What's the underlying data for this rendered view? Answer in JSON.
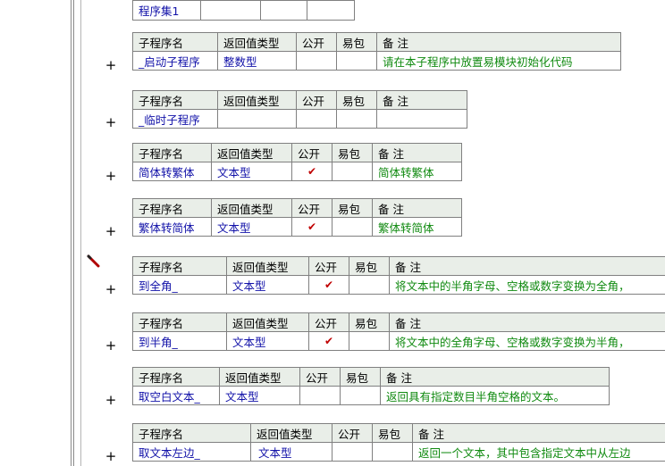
{
  "assembly": {
    "name": "程序集1"
  },
  "header_labels": {
    "sub_name": "子程序名",
    "return_type": "返回值类型",
    "public": "公开",
    "easy_pkg": "易包",
    "note": "备 注"
  },
  "expand_symbol": "+",
  "check_mark": "✔",
  "subs": [
    {
      "name": "_启动子程序",
      "return_type": "整数型",
      "public": "",
      "easy_pkg": "",
      "note": "请在本子程序中放置易模块初始化代码"
    },
    {
      "name": "_临时子程序",
      "return_type": "",
      "public": "",
      "easy_pkg": "",
      "note": ""
    },
    {
      "name": "简体转繁体",
      "return_type": "文本型",
      "public": "✔",
      "easy_pkg": "",
      "note": "简体转繁体"
    },
    {
      "name": "繁体转简体",
      "return_type": "文本型",
      "public": "✔",
      "easy_pkg": "",
      "note": "繁体转简体"
    },
    {
      "name": "到全角_",
      "return_type": "文本型",
      "public": "✔",
      "easy_pkg": "",
      "note": "将文本中的半角字母、空格或数字变换为全角，"
    },
    {
      "name": "到半角_",
      "return_type": "文本型",
      "public": "✔",
      "easy_pkg": "",
      "note": "将文本中的全角字母、空格或数字变换为半角，"
    },
    {
      "name": "取空白文本_",
      "return_type": "文本型",
      "public": "",
      "easy_pkg": "",
      "note": "返回具有指定数目半角空格的文本。"
    },
    {
      "name": "取文本左边_",
      "return_type": "文本型",
      "public": "",
      "easy_pkg": "",
      "note": "返回一个文本，其中包含指定文本中从左边"
    }
  ],
  "colors": {
    "header_bg": "#e9eee8",
    "name_text": "#1111a8",
    "note_text": "#108a10",
    "check": "#c00000",
    "grid": "#808080"
  },
  "icons": {
    "pen": "pencil-icon",
    "expand": "plus-icon"
  }
}
